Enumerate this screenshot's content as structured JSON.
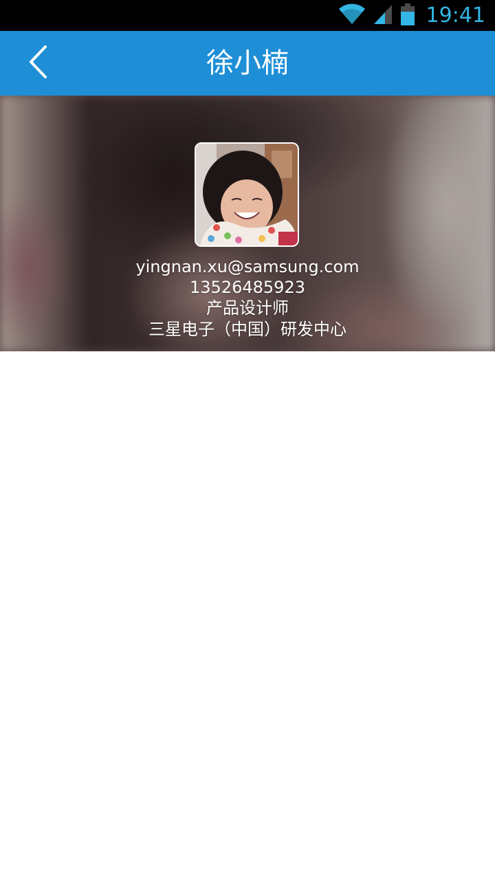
{
  "status_bar": {
    "time": "19:41",
    "icons": [
      "wifi-icon",
      "signal-icon",
      "battery-icon"
    ]
  },
  "header": {
    "title": "徐小楠",
    "back_icon": "chevron-left-icon"
  },
  "profile": {
    "email": "yingnan.xu@samsung.com",
    "phone": "13526485923",
    "job_title": "产品设计师",
    "company": "三星电子（中国）研发中心"
  },
  "colors": {
    "title_bar": "#1e8fd6",
    "status_bar": "#000000",
    "status_accent": "#33b5e5",
    "text_on_header": "#ffffff"
  }
}
